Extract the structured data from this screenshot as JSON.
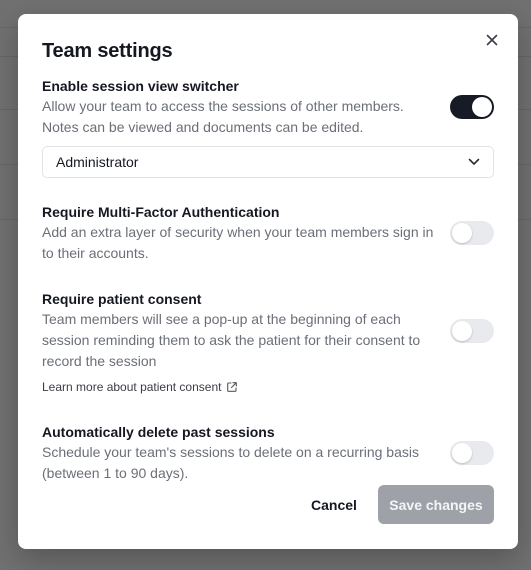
{
  "modal": {
    "title": "Team settings",
    "close_icon": "close-icon"
  },
  "session_switcher": {
    "title": "Enable session view switcher",
    "description": "Allow your team to access the sessions of other members. Notes can be viewed and documents can be edited.",
    "enabled": true,
    "role_select_value": "Administrator",
    "dropdown_icon": "chevron-down-icon"
  },
  "mfa": {
    "title": "Require Multi-Factor Authentication",
    "description": "Add an extra layer of security when your team members sign in to their accounts.",
    "enabled": false
  },
  "patient_consent": {
    "title": "Require patient consent",
    "description": "Team members will see a pop-up at the beginning of each session reminding them to ask the patient for their consent to record the session",
    "enabled": false,
    "learn_more_label": "Learn more about patient consent",
    "learn_more_icon": "external-link-icon"
  },
  "auto_delete": {
    "title": "Automatically delete past sessions",
    "description": "Schedule your team's sessions to delete on a recurring basis (between 1 to 90 days).",
    "enabled": false
  },
  "actions": {
    "cancel_label": "Cancel",
    "save_label": "Save changes"
  },
  "colors": {
    "toggle_on": "#171b26",
    "toggle_off": "#e8eaee",
    "save_disabled": "#9ea1a8"
  }
}
